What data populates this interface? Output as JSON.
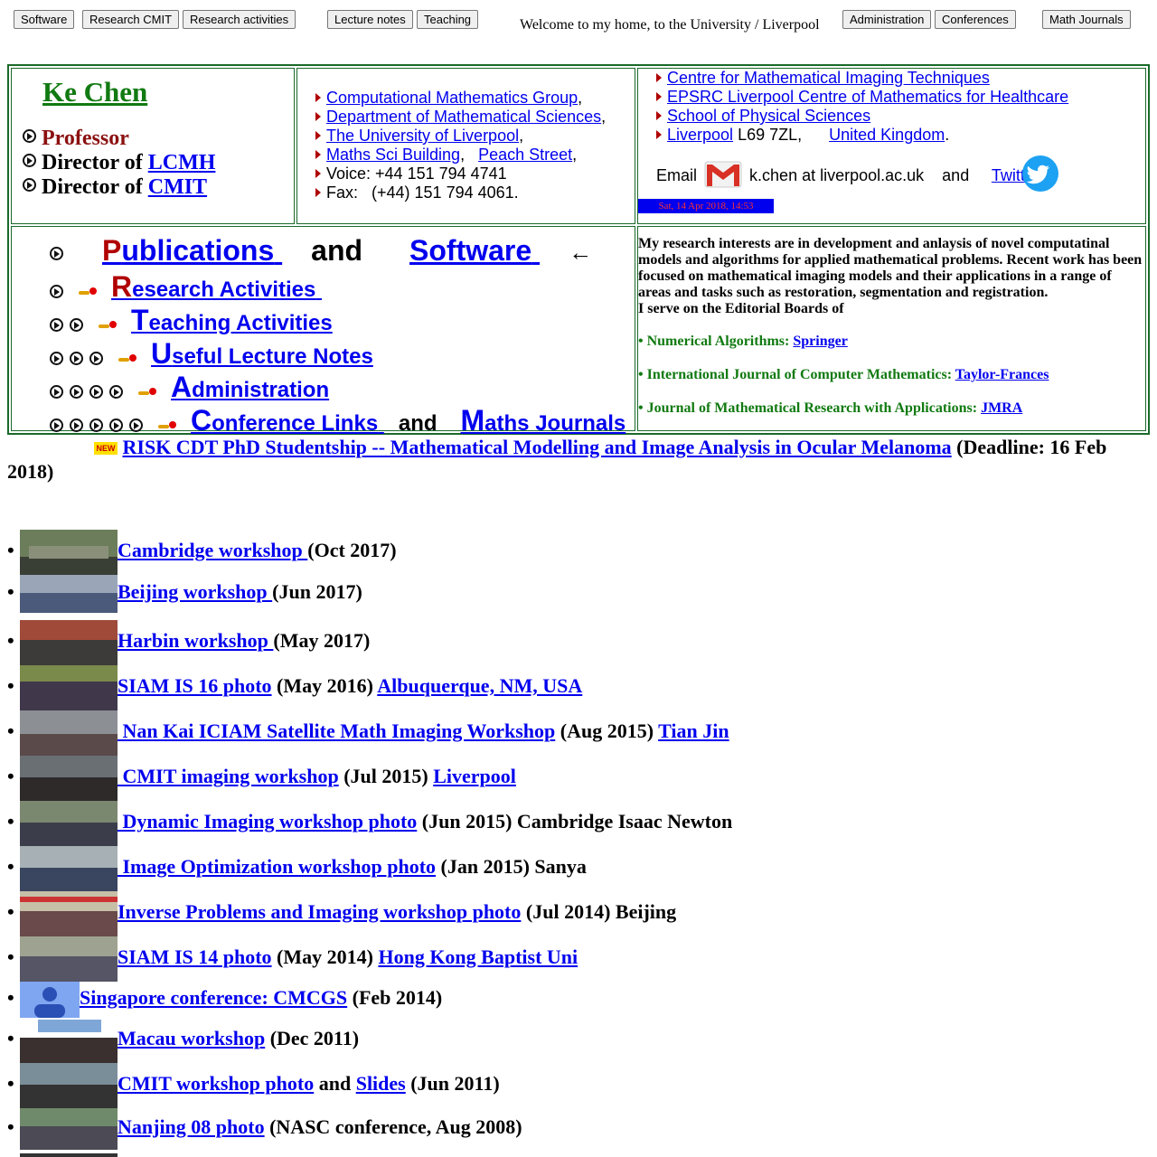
{
  "nav": {
    "software": "Software",
    "research_cmit": "Research CMIT",
    "research_activities": "Research activities",
    "lecture_notes": "Lecture notes",
    "teaching": "Teaching",
    "welcome": "Welcome to my home, to the University / Liverpool",
    "administration": "Administration",
    "conferences": "Conferences",
    "math_journals": "Math Journals"
  },
  "profile": {
    "name": "Ke Chen",
    "professor": "Professor",
    "director_of": "Director of",
    "lcmh": "LCMH",
    "cmit": "CMIT"
  },
  "affiliations": [
    {
      "link": "Computational Mathematics Group",
      "after": ","
    },
    {
      "link": "Department of Mathematical Sciences",
      "after": ","
    },
    {
      "link": "The University of Liverpool",
      "after": ","
    },
    {
      "link": "Maths Sci Building",
      "mid": ",",
      "link2": "Peach Street",
      "after": ","
    }
  ],
  "contact": {
    "voice": "Voice: +44 151 794 4741",
    "fax": "Fax:   (+44) 151 794 4061."
  },
  "centres": {
    "cmit_full": "Centre for Mathematical Imaging Techniques",
    "epsrc": "EPSRC Liverpool Centre of Mathematics for Healthcare",
    "sps": "School of Physical Sciences",
    "liverpool": "Liverpool",
    "postcode": "L69 7ZL,",
    "uk": "United Kingdom",
    "uk_after": "."
  },
  "email": {
    "label": "Email",
    "address": "k.chen at liverpool.ac.uk",
    "and": "and",
    "twitter": "Twitter"
  },
  "datetime": "Sat, 14 Apr 2018, 14:53",
  "sections": {
    "pub_cap": "P",
    "pub_rest": "ublications",
    "and1": "and",
    "software": "Software",
    "arrow": "←",
    "res_cap": "R",
    "res_rest": "esearch Activities",
    "teach_cap": "T",
    "teach_rest": "eaching Activities",
    "useful_cap": "U",
    "useful_rest": "seful Lecture Notes",
    "admin_cap": "A",
    "admin_rest": "dministration",
    "conf_cap": "C",
    "conf_rest": "onference Links",
    "and2": "and",
    "maths_cap": "M",
    "maths_rest": "aths Journals"
  },
  "research": {
    "text": "My research interests are in development and anlaysis of novel computatinal models and algorithms for applied mathematical problems. Recent work has been focused on mathematical imaging models and their applications in a range of areas and tasks such as restoration, segmentation and registration.",
    "editorial": "I serve on the Editorial Boards of",
    "boards": [
      {
        "journal": "• Numerical Algorithms:",
        "publisher": "Springer"
      },
      {
        "journal": "• International Journal of Computer Mathematics:",
        "publisher": "Taylor-Frances"
      },
      {
        "journal": "• Journal of Mathematical Research with Applications:",
        "publisher": "JMRA"
      }
    ]
  },
  "news": {
    "badge": "NEW",
    "link": "RISK CDT PhD Studentship -- Mathematical Modelling and Image Analysis in Ocular Melanoma",
    "tail": "(Deadline: 16 Feb 2018)"
  },
  "workshops": [
    {
      "link": "Cambridge workshop ",
      "rest": "(Oct 2017)"
    },
    {
      "link": "Beijing workshop ",
      "rest": "(Jun 2017)"
    },
    {
      "link": "Harbin workshop ",
      "rest": "(May 2017)"
    },
    {
      "link": "SIAM IS 16 photo",
      "rest": "(May 2016)",
      "link2": "Albuquerque, NM, USA"
    },
    {
      "link": " Nan Kai ICIAM Satellite Math Imaging Workshop",
      "rest": "(Aug 2015)",
      "link2": "Tian Jin"
    },
    {
      "link": " CMIT imaging workshop",
      "rest": "(Jul 2015)",
      "link2": "Liverpool"
    },
    {
      "link": " Dynamic Imaging workshop photo",
      "rest": "(Jun 2015) Cambridge Isaac Newton"
    },
    {
      "link": " Image Optimization workshop photo",
      "rest": "(Jan 2015) Sanya"
    },
    {
      "link": "Inverse Problems and Imaging workshop photo",
      "rest": "(Jul 2014) Beijing"
    },
    {
      "link": "SIAM IS 14 photo",
      "rest": "(May 2014)",
      "link2": "Hong Kong Baptist Uni"
    },
    {
      "link": "Singapore conference: CMCGS",
      "rest": "(Feb 2014)"
    },
    {
      "link": "Macau workshop",
      "rest": "(Dec 2011)"
    },
    {
      "link": "CMIT workshop photo",
      "rest": "and",
      "link2": "Slides",
      "rest2": "(Jun 2011)"
    },
    {
      "link": "Nanjing 08 photo",
      "rest": "(NASC conference, Aug 2008)"
    }
  ],
  "colors": {
    "accent_green": "#117a11",
    "link_blue": "#0000ee",
    "dark_red": "#8b1010",
    "border_green": "#1a6a2a"
  }
}
